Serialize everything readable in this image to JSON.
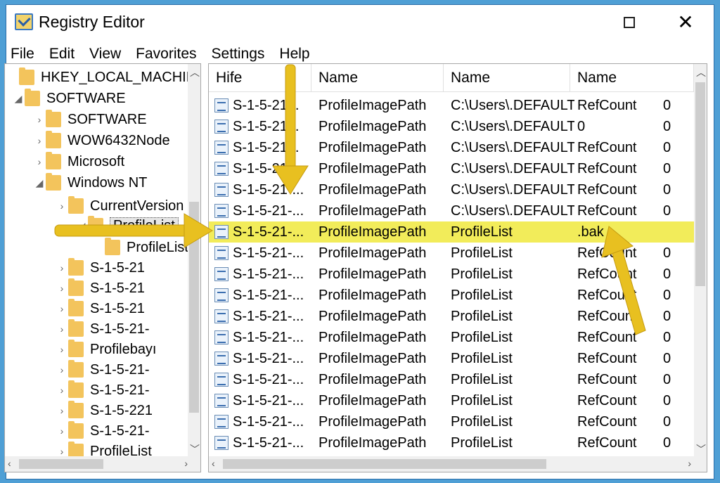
{
  "window": {
    "title": "Registry Editor",
    "maximize_icon": "maximize-icon",
    "close_glyph": "✕"
  },
  "menu": [
    "File",
    "Edit",
    "View",
    "Favorites",
    "Settings",
    "Help"
  ],
  "tree": {
    "items": [
      {
        "label": "HKEY_LOCAL_MACHINE",
        "toggle": ""
      },
      {
        "label": "SOFTWARE",
        "toggle": "◢"
      },
      {
        "label": "SOFTWARE",
        "toggle": "›"
      },
      {
        "label": "WOW6432Node",
        "toggle": "›"
      },
      {
        "label": "Microsoft",
        "toggle": "›"
      },
      {
        "label": "Windows NT",
        "toggle": "◢"
      },
      {
        "label": "CurrentVersion",
        "toggle": "›"
      },
      {
        "label": "ProfileList",
        "toggle": "◢"
      },
      {
        "label": "ProfileList",
        "toggle": ""
      },
      {
        "label": "S-1-5-21",
        "toggle": "›"
      },
      {
        "label": "S-1-5-21",
        "toggle": "›"
      },
      {
        "label": "S-1-5-21",
        "toggle": "›"
      },
      {
        "label": "S-1-5-21-",
        "toggle": "›"
      },
      {
        "label": "Profilebayı",
        "toggle": "›"
      },
      {
        "label": "S-1-5-21-",
        "toggle": "›"
      },
      {
        "label": "S-1-5-21-",
        "toggle": "›"
      },
      {
        "label": "S-1-5-221",
        "toggle": "›"
      },
      {
        "label": "S-1-5-21-",
        "toggle": "›"
      },
      {
        "label": "ProfileList",
        "toggle": "›"
      }
    ]
  },
  "list": {
    "headers": [
      "Hife",
      "Name",
      "Name",
      "Name"
    ],
    "rows": [
      {
        "c1": "S-1-5-21...",
        "c2": "ProfileImagePath",
        "c3": "C:\\Users\\.DEFAULT",
        "c4": "RefCount",
        "c5": "0"
      },
      {
        "c1": "S-1-5-21...",
        "c2": "ProfileImagePath",
        "c3": "C:\\Users\\.DEFAULT",
        "c4": "0",
        "c5": "0"
      },
      {
        "c1": "S-1-5-21...",
        "c2": "ProfileImagePath",
        "c3": "C:\\Users\\.DEFAULT",
        "c4": "RefCount",
        "c5": "0"
      },
      {
        "c1": "S-1-5-21...",
        "c2": "ProfileImagePath",
        "c3": "C:\\Users\\.DEFAULT",
        "c4": "RefCount",
        "c5": "0"
      },
      {
        "c1": "S-1-5-21-...",
        "c2": "ProfileImagePath",
        "c3": "C:\\Users\\.DEFAULT",
        "c4": "RefCount",
        "c5": "0"
      },
      {
        "c1": "S-1-5-21-...",
        "c2": "ProfileImagePath",
        "c3": "C:\\Users\\.DEFAULT",
        "c4": "RefCount",
        "c5": "0"
      },
      {
        "c1": "S-1-5-21-...",
        "c2": "ProfileImagePath",
        "c3": "ProfileList",
        "c4": ".bak",
        "c5": ""
      },
      {
        "c1": "S-1-5-21-...",
        "c2": "ProfileImagePath",
        "c3": "ProfileList",
        "c4": "RefCount",
        "c5": "0"
      },
      {
        "c1": "S-1-5-21-...",
        "c2": "ProfileImagePath",
        "c3": "ProfileList",
        "c4": "RefCount",
        "c5": "0"
      },
      {
        "c1": "S-1-5-21-...",
        "c2": "ProfileImagePath",
        "c3": "ProfileList",
        "c4": "RefCount",
        "c5": "0"
      },
      {
        "c1": "S-1-5-21-...",
        "c2": "ProfileImagePath",
        "c3": "ProfileList",
        "c4": "RefCount",
        "c5": "0"
      },
      {
        "c1": "S-1-5-21-...",
        "c2": "ProfileImagePath",
        "c3": "ProfileList",
        "c4": "RefCount",
        "c5": "0"
      },
      {
        "c1": "S-1-5-21-...",
        "c2": "ProfileImagePath",
        "c3": "ProfileList",
        "c4": "RefCount",
        "c5": "0"
      },
      {
        "c1": "S-1-5-21-...",
        "c2": "ProfileImagePath",
        "c3": "ProfileList",
        "c4": "RefCount",
        "c5": "0"
      },
      {
        "c1": "S-1-5-21-...",
        "c2": "ProfileImagePath",
        "c3": "ProfileList",
        "c4": "RefCount",
        "c5": "0"
      },
      {
        "c1": "S-1-5-21-...",
        "c2": "ProfileImagePath",
        "c3": "ProfileList",
        "c4": "RefCount",
        "c5": "0"
      },
      {
        "c1": "S-1-5-21-...",
        "c2": "ProfileImagePath",
        "c3": "ProfileList",
        "c4": "RefCount",
        "c5": "0"
      }
    ],
    "highlight_row": 6
  },
  "colors": {
    "desktop": "#4f9fd5",
    "highlight": "#f2ec5a",
    "arrow": "#e8c020",
    "folder": "#f3c45c"
  }
}
